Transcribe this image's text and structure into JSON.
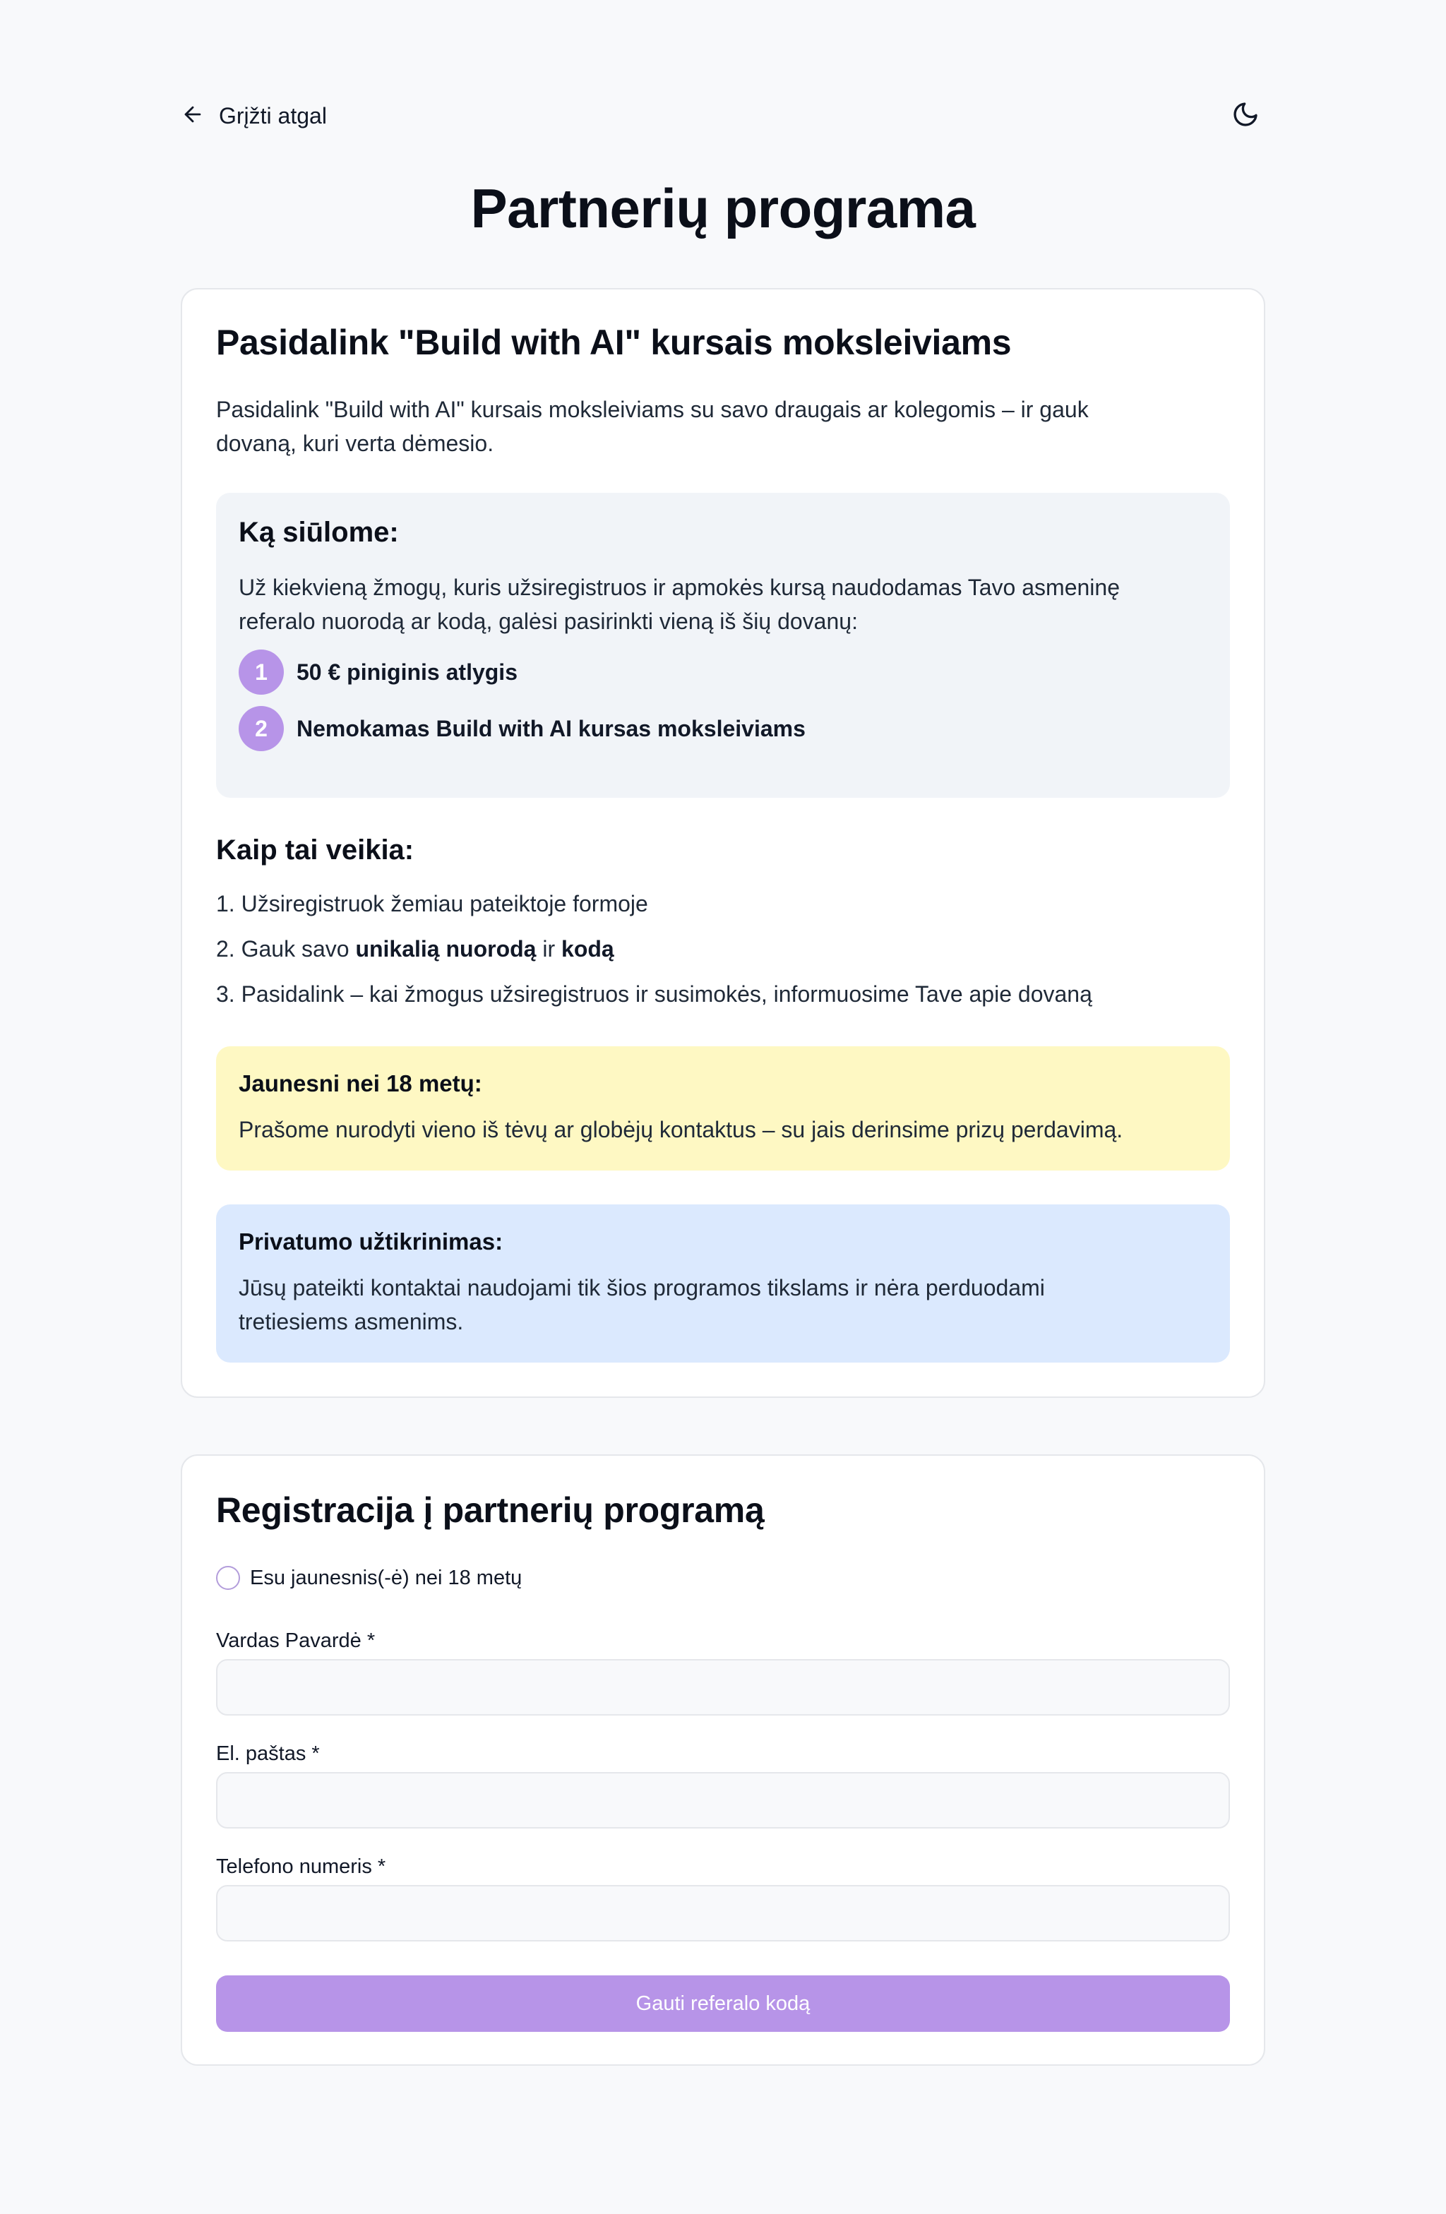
{
  "header": {
    "back_label": "Grįžti atgal",
    "back_icon": "arrow-left-icon",
    "theme_icon": "moon-icon"
  },
  "page_title": "Partnerių programa",
  "info_card": {
    "heading": "Pasidalink \"Build with AI\" kursais moksleiviams",
    "intro_line1": "Pasidalink \"Build with AI\" kursais moksleiviams su savo draugais ar kolegomis – ir gauk",
    "intro_line2": "dovaną, kuri verta dėmesio.",
    "offer": {
      "title": "Ką siūlome:",
      "text_line1": "Už kiekvieną žmogų, kuris užsiregistruos ir apmokės kursą naudodamas Tavo asmeninę",
      "text_line2": "referalo nuorodą ar kodą, galėsi pasirinkti vieną iš šių dovanų:",
      "gifts": [
        {
          "number": "1",
          "label": "50 € piniginis atlygis"
        },
        {
          "number": "2",
          "label": "Nemokamas Build with AI kursas moksleiviams"
        }
      ]
    },
    "how": {
      "title": "Kaip tai veikia:",
      "step1": "1. Užsiregistruok žemiau pateiktoje formoje",
      "step2_pre": "2. Gauk savo ",
      "step2_bold1": "unikalią nuorodą",
      "step2_mid": " ir ",
      "step2_bold2": "kodą",
      "step3": "3. Pasidalink – kai žmogus užsiregistruos ir susimokės, informuosime Tave apie dovaną"
    },
    "minor_notice": {
      "title": "Jaunesni nei 18 metų:",
      "text": "Prašome nurodyti vieno iš tėvų ar globėjų kontaktus – su jais derinsime prizų perdavimą."
    },
    "privacy_notice": {
      "title": "Privatumo užtikrinimas:",
      "text_line1": "Jūsų pateikti kontaktai naudojami tik šios programos tikslams ir nėra perduodami",
      "text_line2": "tretiesiems asmenims."
    }
  },
  "form": {
    "heading": "Registracija į partnerių programą",
    "minor_checkbox_label": "Esu jaunesnis(-ė) nei 18 metų",
    "name_label": "Vardas Pavardė *",
    "name_value": "",
    "email_label": "El. paštas *",
    "email_value": "",
    "phone_label": "Telefono numeris *",
    "phone_value": "",
    "submit_label": "Gauti referalo kodą"
  },
  "colors": {
    "accent": "#b794e8",
    "page_bg": "#f8f9fb",
    "offer_bg": "#f1f4f8",
    "yellow_notice_bg": "#fef8c3",
    "blue_notice_bg": "#dbe9fe"
  }
}
